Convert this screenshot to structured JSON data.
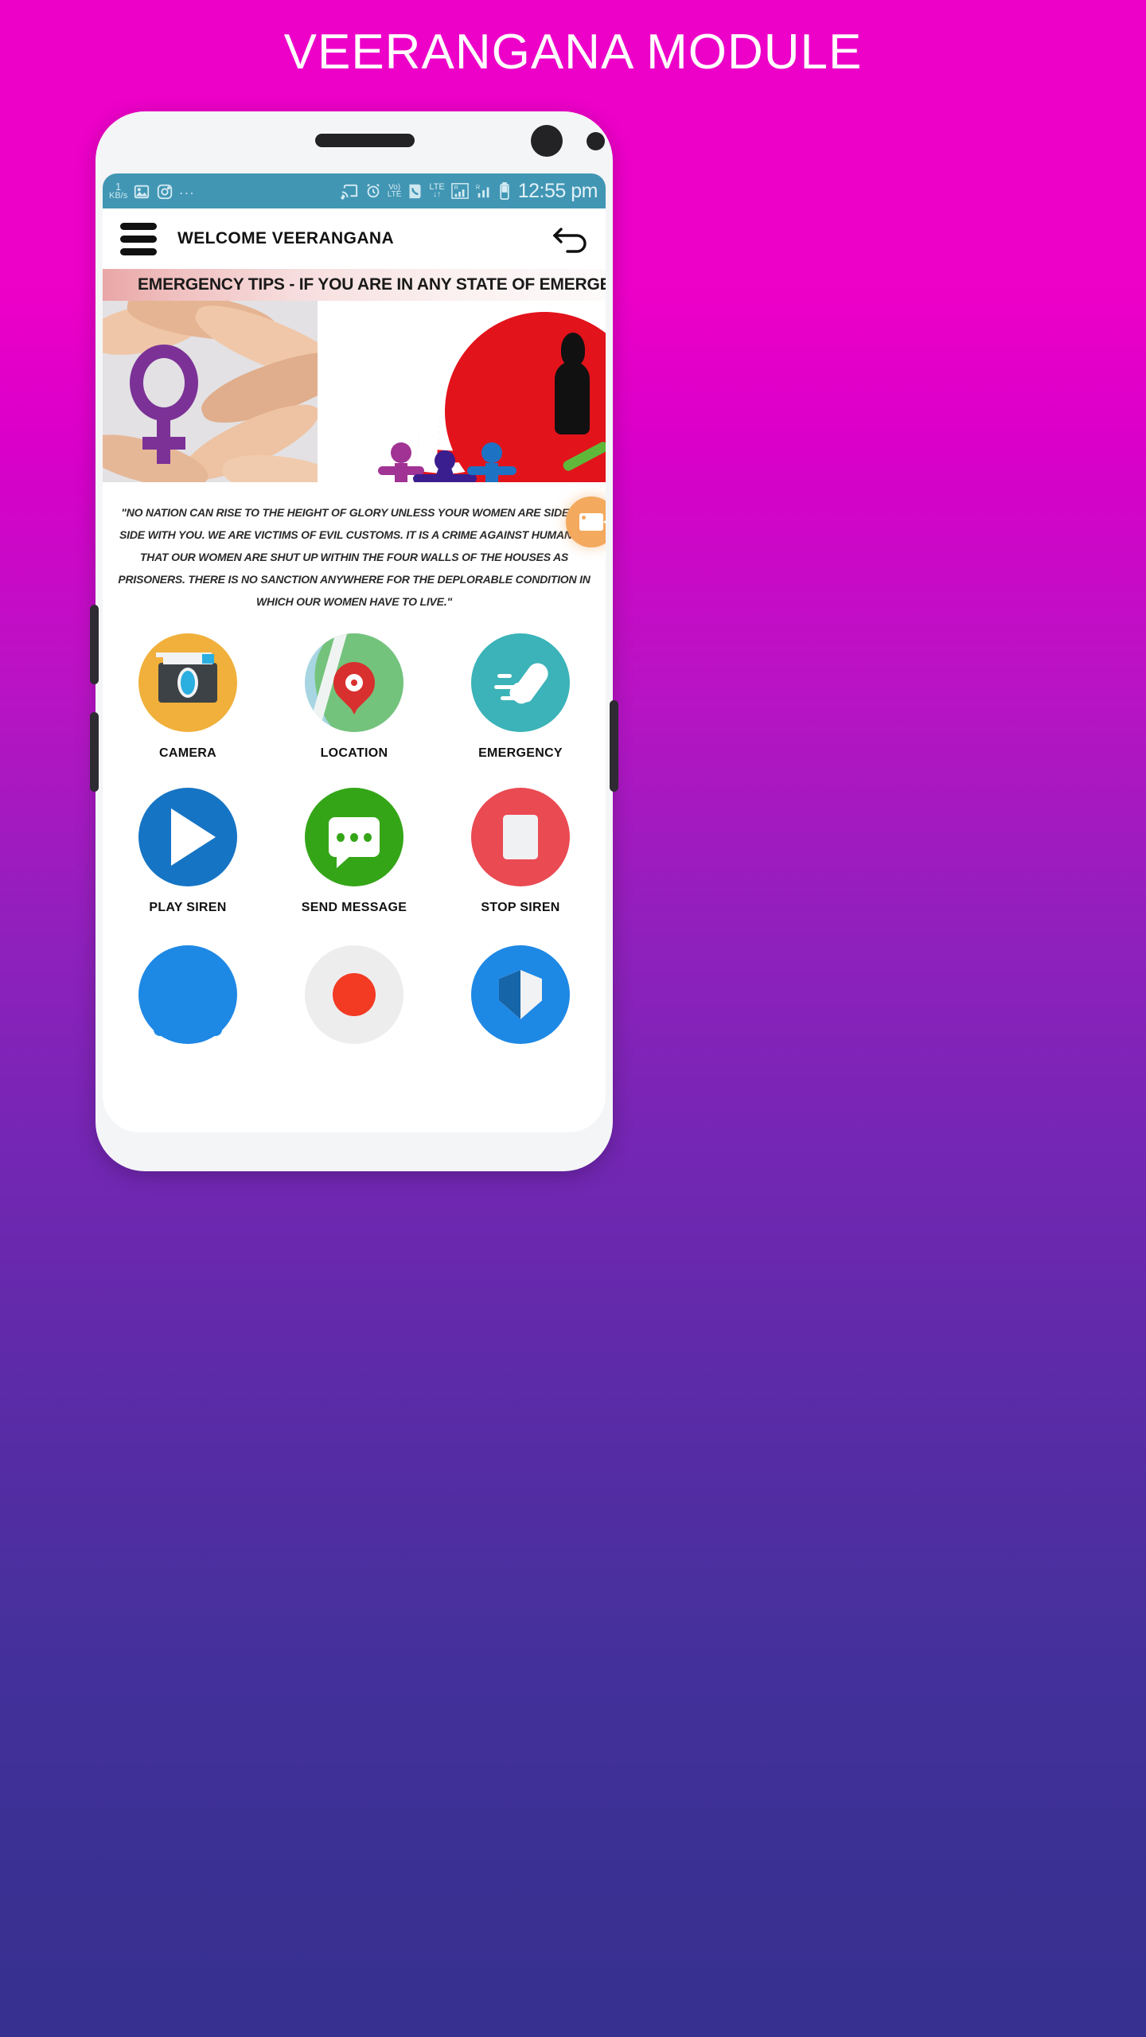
{
  "page": {
    "title": "VEERANGANA MODULE"
  },
  "statusbar": {
    "kbps_value": "1",
    "kbps_unit": "KB/s",
    "overflow_dots": "...",
    "icons": [
      "gallery-icon",
      "instagram-icon",
      "cast-icon",
      "alarm-icon",
      "volte-icon",
      "call-icon",
      "lte-data-icon",
      "signal-r1-icon",
      "signal-r2-icon",
      "battery-icon"
    ],
    "volte_top": "Vo)",
    "volte_bottom": "LTE",
    "lte_label": "LTE",
    "roam1": "R",
    "roam2": "R",
    "time": "12:55 pm"
  },
  "appbar": {
    "menu_icon": "hamburger-menu-icon",
    "title": "WELCOME VEERANGANA",
    "back_icon": "back-arrow-icon"
  },
  "ticker": {
    "text": "EMERGENCY TIPS - IF YOU ARE IN ANY STATE OF EMERGENCY , P"
  },
  "carousel": {
    "slides": [
      {
        "name": "hands-venus-symbol-image",
        "alt": "Hands forming circle with purple female gender symbol"
      },
      {
        "name": "red-hand-protection-image",
        "alt": "Red hand circle with woman silhouette and stick figures"
      }
    ]
  },
  "quote": {
    "text": "\"NO NATION CAN RISE TO THE HEIGHT OF GLORY UNLESS YOUR WOMEN ARE SIDE BY SIDE WITH YOU. WE ARE VICTIMS OF EVIL CUSTOMS. IT IS A CRIME AGAINST HUMANITY THAT OUR WOMEN ARE SHUT UP WITHIN THE FOUR WALLS OF THE HOUSES AS PRISONERS. THERE IS NO SANCTION ANYWHERE FOR THE DEPLORABLE CONDITION IN WHICH OUR WOMEN HAVE TO LIVE.\""
  },
  "actions": {
    "rows": [
      [
        {
          "label": "CAMERA",
          "icon": "camera-icon",
          "color": "#F0B03B"
        },
        {
          "label": "LOCATION",
          "icon": "map-pin-icon",
          "color": "#A8D5E2"
        },
        {
          "label": "EMERGENCY",
          "icon": "phone-call-icon",
          "color": "#3BB3B8"
        }
      ],
      [
        {
          "label": "PLAY SIREN",
          "icon": "play-icon",
          "color": "#1674C4"
        },
        {
          "label": "SEND MESSAGE",
          "icon": "message-icon",
          "color": "#35A518"
        },
        {
          "label": "STOP SIREN",
          "icon": "stop-icon",
          "color": "#EA4A52"
        }
      ],
      [
        {
          "label": "",
          "icon": "headphone-icon",
          "color": "#1E88E5"
        },
        {
          "label": "",
          "icon": "record-icon",
          "color": "#EDEDED"
        },
        {
          "label": "",
          "icon": "shield-icon",
          "color": "#1E88E5"
        }
      ]
    ]
  },
  "fab": {
    "icon": "video-camera-icon",
    "color": "#F3A95E"
  },
  "colors": {
    "bg_top": "#ED00C8",
    "bg_bottom": "#3A3093",
    "statusbar": "#4196B4",
    "phone_frame": "#F4F5F7"
  }
}
